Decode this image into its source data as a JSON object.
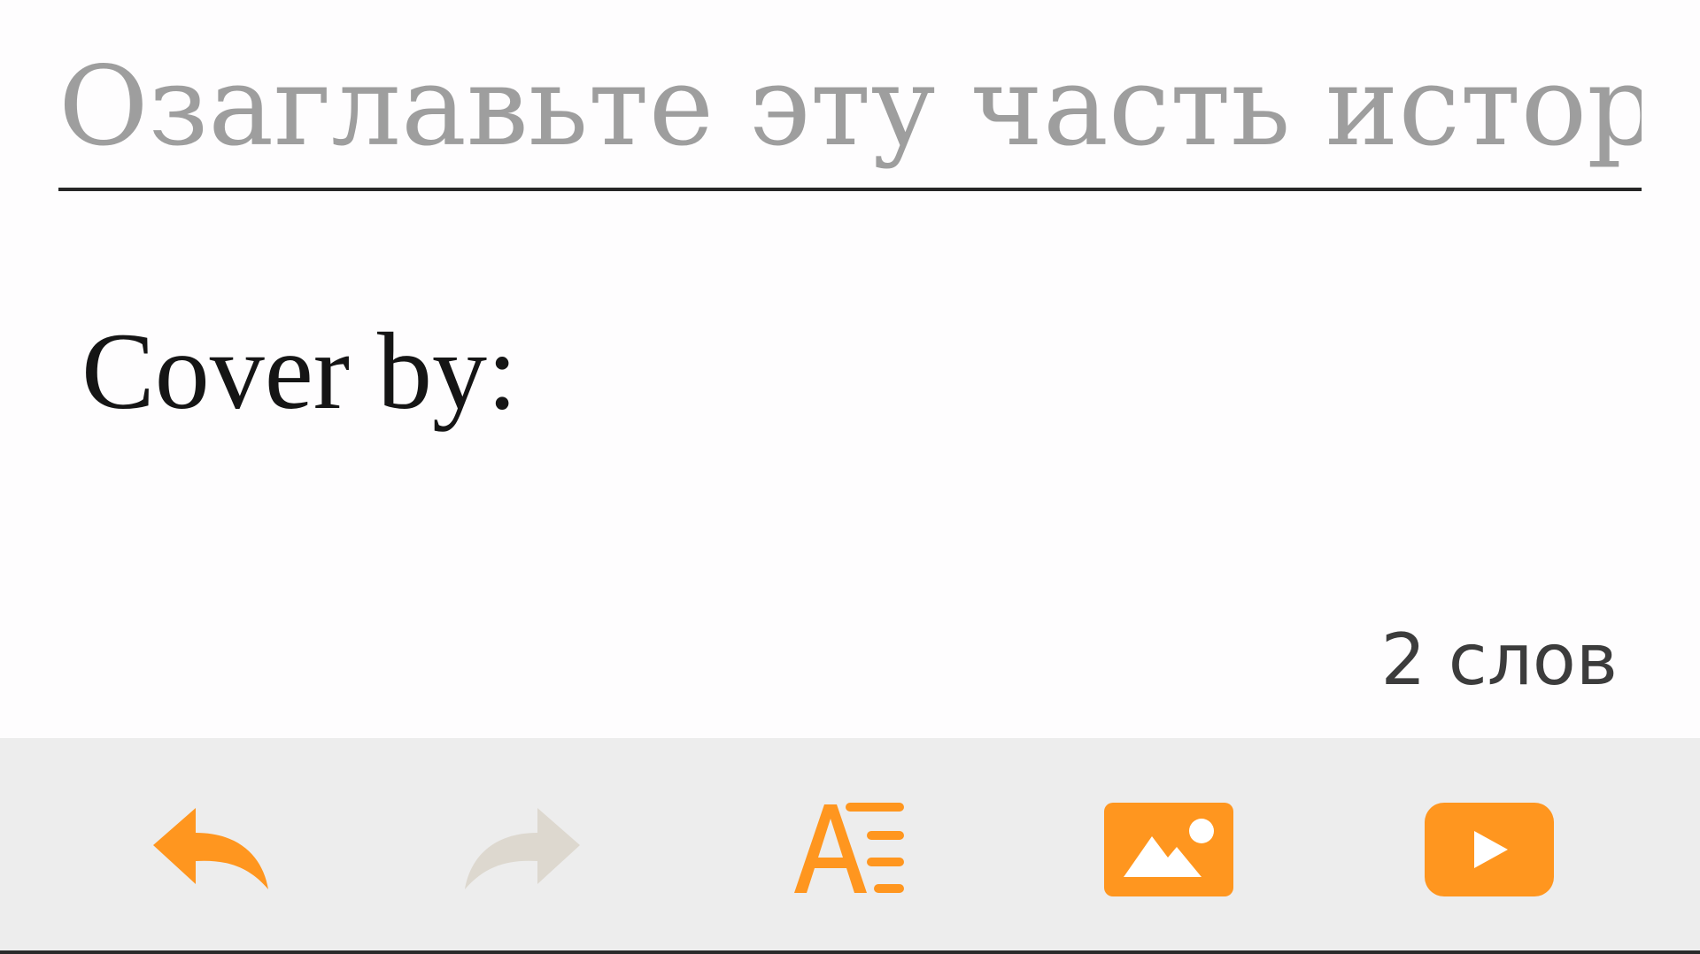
{
  "editor": {
    "title_placeholder": "Озаглавьте эту часть истории",
    "title_value": "",
    "body_text": "Cover by:",
    "word_count": "2 слов"
  },
  "toolbar": {
    "items": [
      {
        "name": "undo",
        "icon": "undo-arrow-icon",
        "enabled": true
      },
      {
        "name": "redo",
        "icon": "redo-arrow-icon",
        "enabled": false
      },
      {
        "name": "text-format",
        "icon": "text-format-icon",
        "enabled": true
      },
      {
        "name": "insert-image",
        "icon": "image-icon",
        "enabled": true
      },
      {
        "name": "insert-video",
        "icon": "video-play-icon",
        "enabled": true
      }
    ]
  },
  "colors": {
    "accent": "#ff961f",
    "disabled": "#ddd8cf",
    "toolbar_bg": "#ededed",
    "text": "#151515",
    "placeholder": "#9e9e9e"
  }
}
